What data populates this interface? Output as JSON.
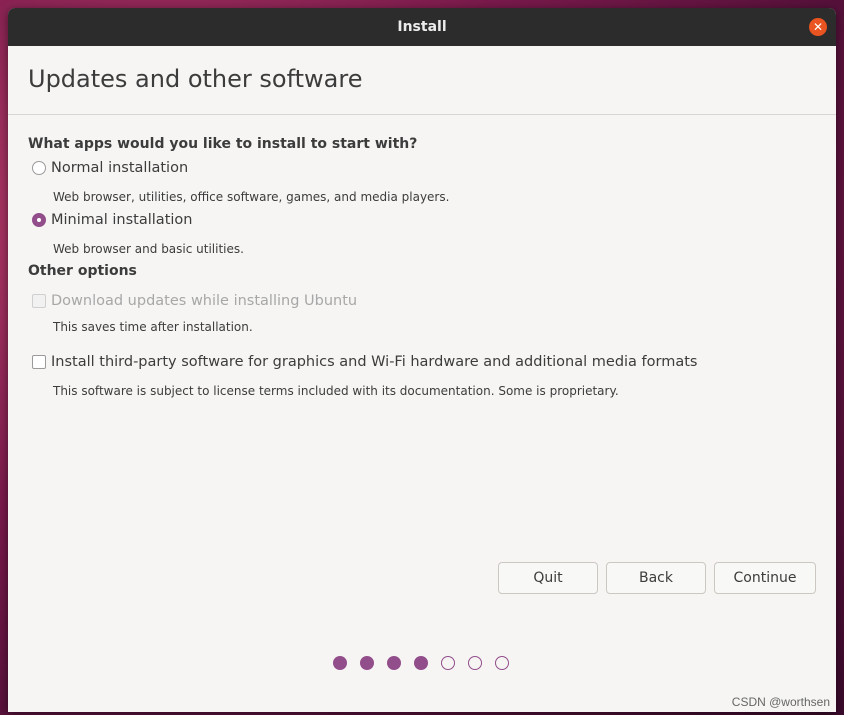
{
  "window": {
    "title": "Install"
  },
  "page": {
    "heading": "Updates and other software"
  },
  "apps_section": {
    "title": "What apps would you like to install to start with?",
    "options": [
      {
        "label": "Normal installation",
        "description": "Web browser, utilities, office software, games, and media players.",
        "selected": false
      },
      {
        "label": "Minimal installation",
        "description": "Web browser and basic utilities.",
        "selected": true
      }
    ]
  },
  "other_section": {
    "title": "Other options",
    "options": [
      {
        "label": "Download updates while installing Ubuntu",
        "description": "This saves time after installation.",
        "checked": false,
        "enabled": false
      },
      {
        "label": "Install third-party software for graphics and Wi-Fi hardware and additional media formats",
        "description": "This software is subject to license terms included with its documentation. Some is proprietary.",
        "checked": false,
        "enabled": true
      }
    ]
  },
  "buttons": {
    "quit": "Quit",
    "back": "Back",
    "continue": "Continue"
  },
  "progress": {
    "total_steps": 7,
    "completed_steps": 4
  },
  "colors": {
    "accent": "#924d8b",
    "close": "#e95420",
    "titlebar": "#2c2c2c"
  },
  "watermark": "CSDN @worthsen"
}
